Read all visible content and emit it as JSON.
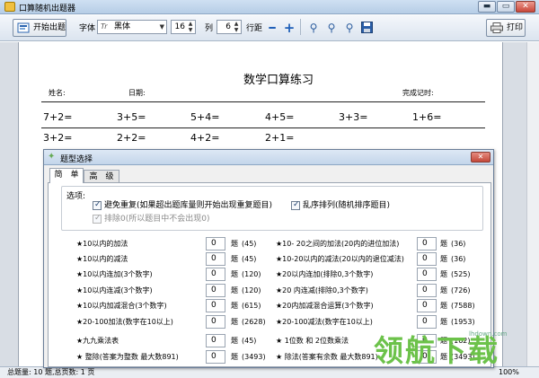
{
  "window": {
    "title": "口算随机出题器",
    "minimize_label": "▬",
    "maximize_label": "▭",
    "close_label": "✕",
    "accent": "#1c5fb5"
  },
  "toolbar": {
    "start_label": "开始出题",
    "font_label": "字体",
    "font_value": "黑体",
    "font_size_value": "16",
    "columns_label": "列",
    "columns_value": "6",
    "line_spacing_label": "行距",
    "print_label": "打印"
  },
  "paper": {
    "title": "数学口算练习",
    "name_label": "姓名:",
    "date_label": "日期:",
    "time_label": "完成记时:",
    "row1": [
      "7+2=",
      "3+5=",
      "5+4=",
      "4+5=",
      "3+3=",
      "1+6="
    ],
    "row2": [
      "3+2=",
      "2+2=",
      "4+2=",
      "2+1="
    ]
  },
  "dialog": {
    "title": "题型选择",
    "close_label": "✕",
    "tabs": [
      "简　单",
      "高　级"
    ],
    "options_label": "选项:",
    "options": {
      "avoid_repeat": "避免重复(如果超出题库量则开始出现重复题目)",
      "shuffle": "乱序排列(随机排序题目)",
      "exclude_zero": "排除0(所以题目中不会出现0)"
    },
    "unit": "题",
    "left_items": [
      {
        "label": "★10以内的加法",
        "value": "0",
        "count": "(45)"
      },
      {
        "label": "★10以内的减法",
        "value": "0",
        "count": "(45)"
      },
      {
        "label": "★10以内连加(3个数字)",
        "value": "0",
        "count": "(120)"
      },
      {
        "label": "★10以内连减(3个数字)",
        "value": "0",
        "count": "(120)"
      },
      {
        "label": "★10以内加减混合(3个数字)",
        "value": "0",
        "count": "(615)"
      },
      {
        "label": "★20-100加法(数字在10以上)",
        "value": "0",
        "count": "(2628)"
      },
      {
        "label": "★九九乘法表",
        "value": "0",
        "count": "(45)"
      },
      {
        "label": "★ 整除(答案为整数 最大数891)",
        "value": "0",
        "count": "(3493)"
      }
    ],
    "right_items": [
      {
        "label": "★10- 20之间的加法(20内的进位加法)",
        "value": "0",
        "count": "(36)"
      },
      {
        "label": "★10-20以内的减法(20以内的退位减法)",
        "value": "0",
        "count": "(36)"
      },
      {
        "label": "★20以内连加(排除0,3个数字)",
        "value": "0",
        "count": "(525)"
      },
      {
        "label": "★20 内连减(排除0,3个数字)",
        "value": "0",
        "count": "(726)"
      },
      {
        "label": "★20内加减混合运算(3个数字)",
        "value": "0",
        "count": "(7588)"
      },
      {
        "label": "★20-100减法(数字在10以上)",
        "value": "0",
        "count": "(1953)"
      },
      {
        "label": "★ 1位数 和 2位数乘法",
        "value": "0",
        "count": "(162)"
      },
      {
        "label": "★ 除法(答案有余数 最大数891)",
        "value": "0",
        "count": "(3493)"
      }
    ]
  },
  "statusbar": {
    "info": "总题量: 10 题,总页数: 1 页",
    "zoom": "100%"
  },
  "watermark": {
    "text": "领航下载",
    "url": "lhdown.com"
  }
}
